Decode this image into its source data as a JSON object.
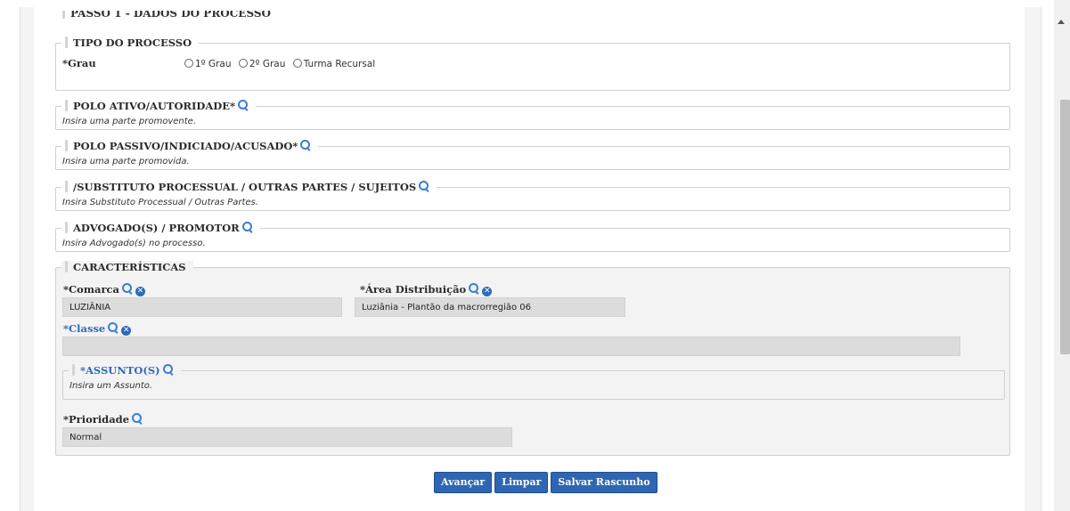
{
  "step": {
    "title": "PASSO 1 - DADOS DO PROCESSO"
  },
  "tipo_processo": {
    "legend": "TIPO DO PROCESSO",
    "grau_label": "*Grau",
    "options": [
      "1º Grau",
      "2º Grau",
      "Turma Recursal"
    ]
  },
  "polo_ativo": {
    "legend": "POLO ATIVO/AUTORIDADE*",
    "hint": "Insira uma parte promovente."
  },
  "polo_passivo": {
    "legend": "POLO PASSIVO/INDICIADO/ACUSADO*",
    "hint": "Insira uma parte promovida."
  },
  "substituto": {
    "legend": "/SUBSTITUTO PROCESSUAL / OUTRAS PARTES / SUJEITOS",
    "hint": "Insira Substituto Processual / Outras Partes."
  },
  "advogado": {
    "legend": "ADVOGADO(S) / PROMOTOR",
    "hint": "Insira Advogado(s) no processo."
  },
  "caracteristicas": {
    "legend": "CARACTERÍSTICAS",
    "comarca_label": "*Comarca",
    "comarca_value": "LUZIÂNIA",
    "area_label": "*Área Distribuição",
    "area_value": "Luziânia - Plantão da macrorregião 06",
    "classe_label": "*Classe",
    "classe_value": "",
    "assunto_legend": "*ASSUNTO(S)",
    "assunto_hint": "Insira um Assunto.",
    "prioridade_label": "*Prioridade",
    "prioridade_value": "Normal"
  },
  "buttons": {
    "avancar": "Avançar",
    "limpar": "Limpar",
    "salvar": "Salvar Rascunho"
  },
  "colors": {
    "accent": "#2f66b3",
    "field_bg": "#dcdcdc"
  }
}
